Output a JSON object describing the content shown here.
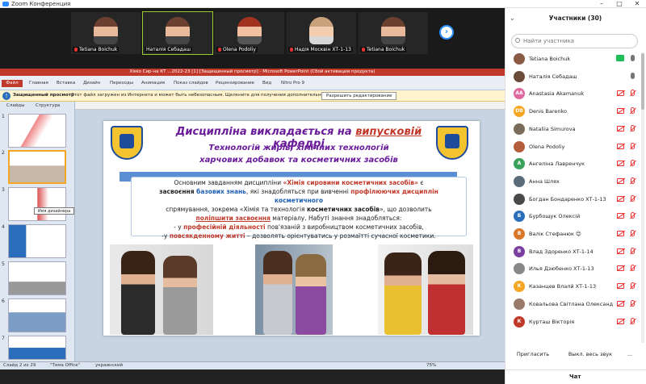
{
  "window": {
    "title": "Zoom Конференция",
    "minimize": "–",
    "maximize": "□",
    "close": "✕"
  },
  "gallery": {
    "tiles": [
      {
        "name": "Tetiana Boichuk",
        "muted": true
      },
      {
        "name": "Наталія Себадаш",
        "muted": false
      },
      {
        "name": "Olena Podoliy",
        "muted": true
      },
      {
        "name": "Надія Москвін ХТ-1-13",
        "muted": true
      },
      {
        "name": "Tetiana Boichuk",
        "muted": true
      }
    ],
    "next_icon": "chevron-right-icon"
  },
  "ppt": {
    "title": "Хіміо Сир-на КТ ...2022-23 [1] [Защищенный просмотр] - Microsoft PowerPoint (Сбой активации продукта)",
    "file_tab": "Файл",
    "tabs": [
      "Главная",
      "Вставка",
      "Дизайн",
      "Переходы",
      "Анимация",
      "Показ слайдов",
      "Рецензирование",
      "Вид",
      "Nitro Pro 9"
    ],
    "warning_title": "Защищенный просмотр",
    "warning_text": "Этот файл загружен из Интернета и может быть небезопасным. Щелкните для получения дополнительных сведений.",
    "warning_button": "Разрешить редактирование",
    "pane_tabs": [
      "Слайды",
      "Структура"
    ],
    "slide_numbers": [
      "1",
      "2",
      "3",
      "4",
      "5",
      "6",
      "7"
    ],
    "tooltip": "Имя дизайнера",
    "status": {
      "slide": "Слайд 2 из 29",
      "theme": "\"Тема Office\"",
      "lang": "украинский",
      "zoom": "75%"
    }
  },
  "slide": {
    "heading_pre": "Дисципліна викладається на ",
    "heading_underlined": "випусковій",
    "heading_post": " кафедрі",
    "sub1": "Технологій жирів, хімічних технологій",
    "sub2": "харчових добавок та косметичних засобів",
    "t1": "Основним завданням дисципліни ",
    "t2": "«Хімія сировини косметичних засобів»",
    "t3": " є",
    "t4": "засвоєння ",
    "t5": "базових знань",
    "t6": ", які знадобляться при вивченні ",
    "t7": "профілюючих дисциплін ",
    "t8": "косметичного",
    "t9": "спрямування, зокрема «Хімія та технологія ",
    "t10": "косметичних засобів",
    "t11": "», що дозволить",
    "t12": "поліпшити засвоєння",
    "t13": " матеріалу. Набуті знання знадобляться:",
    "t14": "- у ",
    "t15": "професійній діяльності",
    "t16": " пов'язаній з виробництвом косметичних засобів,",
    "t17": "-у ",
    "t18": "повсякденному житті",
    "t19": " – дозволять орієнтуватись у розмаїтті сучасної косметики."
  },
  "participants": {
    "header": "Участники (30)",
    "search_placeholder": "Найти участника",
    "list": [
      {
        "initials": "",
        "name": "Tetiana Boichuk",
        "color": "#8a5a44",
        "sharing": true,
        "mic_on": true
      },
      {
        "initials": "",
        "name": "Наталія Себадаш",
        "color": "#6b4c3b",
        "sharing": false,
        "mic_on": true
      },
      {
        "initials": "AA",
        "name": "Anastasia Akamanuk",
        "color": "#e06aa0",
        "sharing": false,
        "mic_on": false
      },
      {
        "initials": "DB",
        "name": "Denis Barenko",
        "color": "#f5a623",
        "sharing": false,
        "mic_on": false
      },
      {
        "initials": "",
        "name": "Nataliia Simurova",
        "color": "#7a6b5d",
        "sharing": false,
        "mic_on": false
      },
      {
        "initials": "",
        "name": "Olena Podoliy",
        "color": "#b35d3a",
        "sharing": false,
        "mic_on": false
      },
      {
        "initials": "A",
        "name": "Ангеліна Лавренчук",
        "color": "#3aa35a",
        "sharing": false,
        "mic_on": false
      },
      {
        "initials": "",
        "name": "Анна Шлях",
        "color": "#5a6b7a",
        "sharing": false,
        "mic_on": false
      },
      {
        "initials": "",
        "name": "Богдан Бондаренко ХТ-1-13",
        "color": "#4a4a4a",
        "sharing": false,
        "mic_on": false
      },
      {
        "initials": "Б",
        "name": "Бурбощук Олексій",
        "color": "#2a6ebb",
        "sharing": false,
        "mic_on": false
      },
      {
        "initials": "В",
        "name": "Валік Стефанюк 😊",
        "color": "#d9772a",
        "sharing": false,
        "mic_on": false
      },
      {
        "initials": "В",
        "name": "Влад Здоренко ХТ-1-14",
        "color": "#7b3fa0",
        "sharing": false,
        "mic_on": false
      },
      {
        "initials": "",
        "name": "Илья Дзюбенко ХТ-1-13",
        "color": "#888888",
        "sharing": false,
        "mic_on": false
      },
      {
        "initials": "К",
        "name": "Казанцев Влалй ХТ-1-13",
        "color": "#f5a623",
        "sharing": false,
        "mic_on": false
      },
      {
        "initials": "",
        "name": "Ковальова Світлана Олександ...",
        "color": "#9a7a6a",
        "sharing": false,
        "mic_on": false
      },
      {
        "initials": "К",
        "name": "Курташ Вікторія",
        "color": "#c0392b",
        "sharing": false,
        "mic_on": false
      }
    ],
    "invite": "Пригласить",
    "mute_all": "Выкл. весь звук",
    "more": "...",
    "chat": "Чат"
  }
}
